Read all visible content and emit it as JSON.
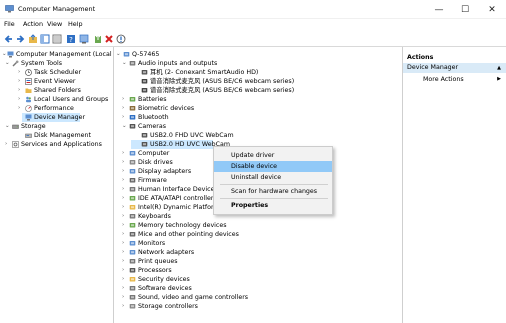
{
  "window": {
    "title": "Computer Management",
    "controls": [
      "—",
      "☐",
      "✕"
    ]
  },
  "menu": [
    "File",
    "Action",
    "View",
    "Help"
  ],
  "toolbar_icons": [
    "back-icon",
    "forward-icon",
    "up-icon",
    "show-hide-tree-icon",
    "export-list-icon",
    "help-icon",
    "device-tree-icon",
    "update-driver-icon",
    "uninstall-icon",
    "scan-hardware-icon"
  ],
  "tree": [
    {
      "label": "Computer Management (Local",
      "icon": "computer-management-icon",
      "arrow": "⌄"
    },
    {
      "label": "System Tools",
      "icon": "tools-icon",
      "arrow": "⌄"
    },
    {
      "label": "Task Scheduler",
      "icon": "clock-icon",
      "arrow": "›"
    },
    {
      "label": "Event Viewer",
      "icon": "event-viewer-icon",
      "arrow": "›"
    },
    {
      "label": "Shared Folders",
      "icon": "folder-icon",
      "arrow": "›"
    },
    {
      "label": "Local Users and Groups",
      "icon": "users-icon",
      "arrow": "›"
    },
    {
      "label": "Performance",
      "icon": "performance-icon",
      "arrow": "›"
    },
    {
      "label": "Device Manager",
      "icon": "device-manager-icon",
      "arrow": ""
    },
    {
      "label": "Storage",
      "icon": "storage-icon",
      "arrow": "⌄"
    },
    {
      "label": "Disk Management",
      "icon": "disk-management-icon",
      "arrow": ""
    },
    {
      "label": "Services and Applications",
      "icon": "services-icon",
      "arrow": "›"
    }
  ],
  "devices": [
    {
      "label": "Q-57465",
      "icon": "computer-icon",
      "arrow": "⌄"
    },
    {
      "label": "Audio inputs and outputs",
      "icon": "speaker-icon",
      "arrow": "⌄"
    },
    {
      "label": "耳机 (2- Conexant SmartAudio HD)",
      "icon": "headphones-icon",
      "arrow": ""
    },
    {
      "label": "谱音消除式麦克风 (ASUS BE/C6 webcam series)",
      "icon": "microphone-icon",
      "arrow": ""
    },
    {
      "label": "谱音消除式麦克风 (ASUS BE/C6 webcam series)",
      "icon": "microphone-icon",
      "arrow": ""
    },
    {
      "label": "Batteries",
      "icon": "battery-icon",
      "arrow": "›"
    },
    {
      "label": "Biometric devices",
      "icon": "fingerprint-icon",
      "arrow": "›"
    },
    {
      "label": "Bluetooth",
      "icon": "bluetooth-icon",
      "arrow": "›"
    },
    {
      "label": "Cameras",
      "icon": "camera-icon",
      "arrow": "⌄"
    },
    {
      "label": "USB2.0 FHD UVC WebCam",
      "icon": "webcam-icon",
      "arrow": ""
    },
    {
      "label": "USB2.0 HD UVC WebCam",
      "icon": "webcam-icon",
      "arrow": ""
    },
    {
      "label": "Computer",
      "icon": "monitor-icon",
      "arrow": "›"
    },
    {
      "label": "Disk drives",
      "icon": "disk-icon",
      "arrow": "›"
    },
    {
      "label": "Display adapters",
      "icon": "display-icon",
      "arrow": "›"
    },
    {
      "label": "Firmware",
      "icon": "chip-icon",
      "arrow": "›"
    },
    {
      "label": "Human Interface Devices",
      "icon": "hid-icon",
      "arrow": "›"
    },
    {
      "label": "IDE ATA/ATAPI controllers",
      "icon": "ide-icon",
      "arrow": "›"
    },
    {
      "label": "Intel(R) Dynamic Platform an",
      "icon": "folder-icon",
      "arrow": "›"
    },
    {
      "label": "Keyboards",
      "icon": "keyboard-icon",
      "arrow": "›"
    },
    {
      "label": "Memory technology devices",
      "icon": "memory-icon",
      "arrow": "›"
    },
    {
      "label": "Mice and other pointing devices",
      "icon": "mouse-icon",
      "arrow": "›"
    },
    {
      "label": "Monitors",
      "icon": "monitor-icon",
      "arrow": "›"
    },
    {
      "label": "Network adapters",
      "icon": "network-icon",
      "arrow": "›"
    },
    {
      "label": "Print queues",
      "icon": "printer-icon",
      "arrow": "›"
    },
    {
      "label": "Processors",
      "icon": "processor-icon",
      "arrow": "›"
    },
    {
      "label": "Security devices",
      "icon": "security-icon",
      "arrow": "›"
    },
    {
      "label": "Software devices",
      "icon": "software-icon",
      "arrow": "›"
    },
    {
      "label": "Sound, video and game controllers",
      "icon": "sound-icon",
      "arrow": "›"
    },
    {
      "label": "Storage controllers",
      "icon": "storage-controller-icon",
      "arrow": "›"
    }
  ],
  "context_menu": {
    "items": [
      {
        "label": "Update driver",
        "bold": false
      },
      {
        "label": "Disable device",
        "bold": false
      },
      {
        "label": "Uninstall device",
        "bold": false
      },
      {
        "label": "Scan for hardware changes",
        "bold": false
      },
      {
        "label": "Properties",
        "bold": true
      }
    ]
  },
  "actions": {
    "heading": "Actions",
    "section": "Device Manager",
    "section_arrow": "▲",
    "item": "More Actions",
    "item_arrow": "▶"
  },
  "colors": {
    "selection": "#cce8ff",
    "menu_highlight": "#91c9f7",
    "actions_section": "#d9eaf7",
    "toolbar_blue": "#2e6fc4",
    "delete_red": "#d32020",
    "folder_yellow": "#e8b84a"
  }
}
